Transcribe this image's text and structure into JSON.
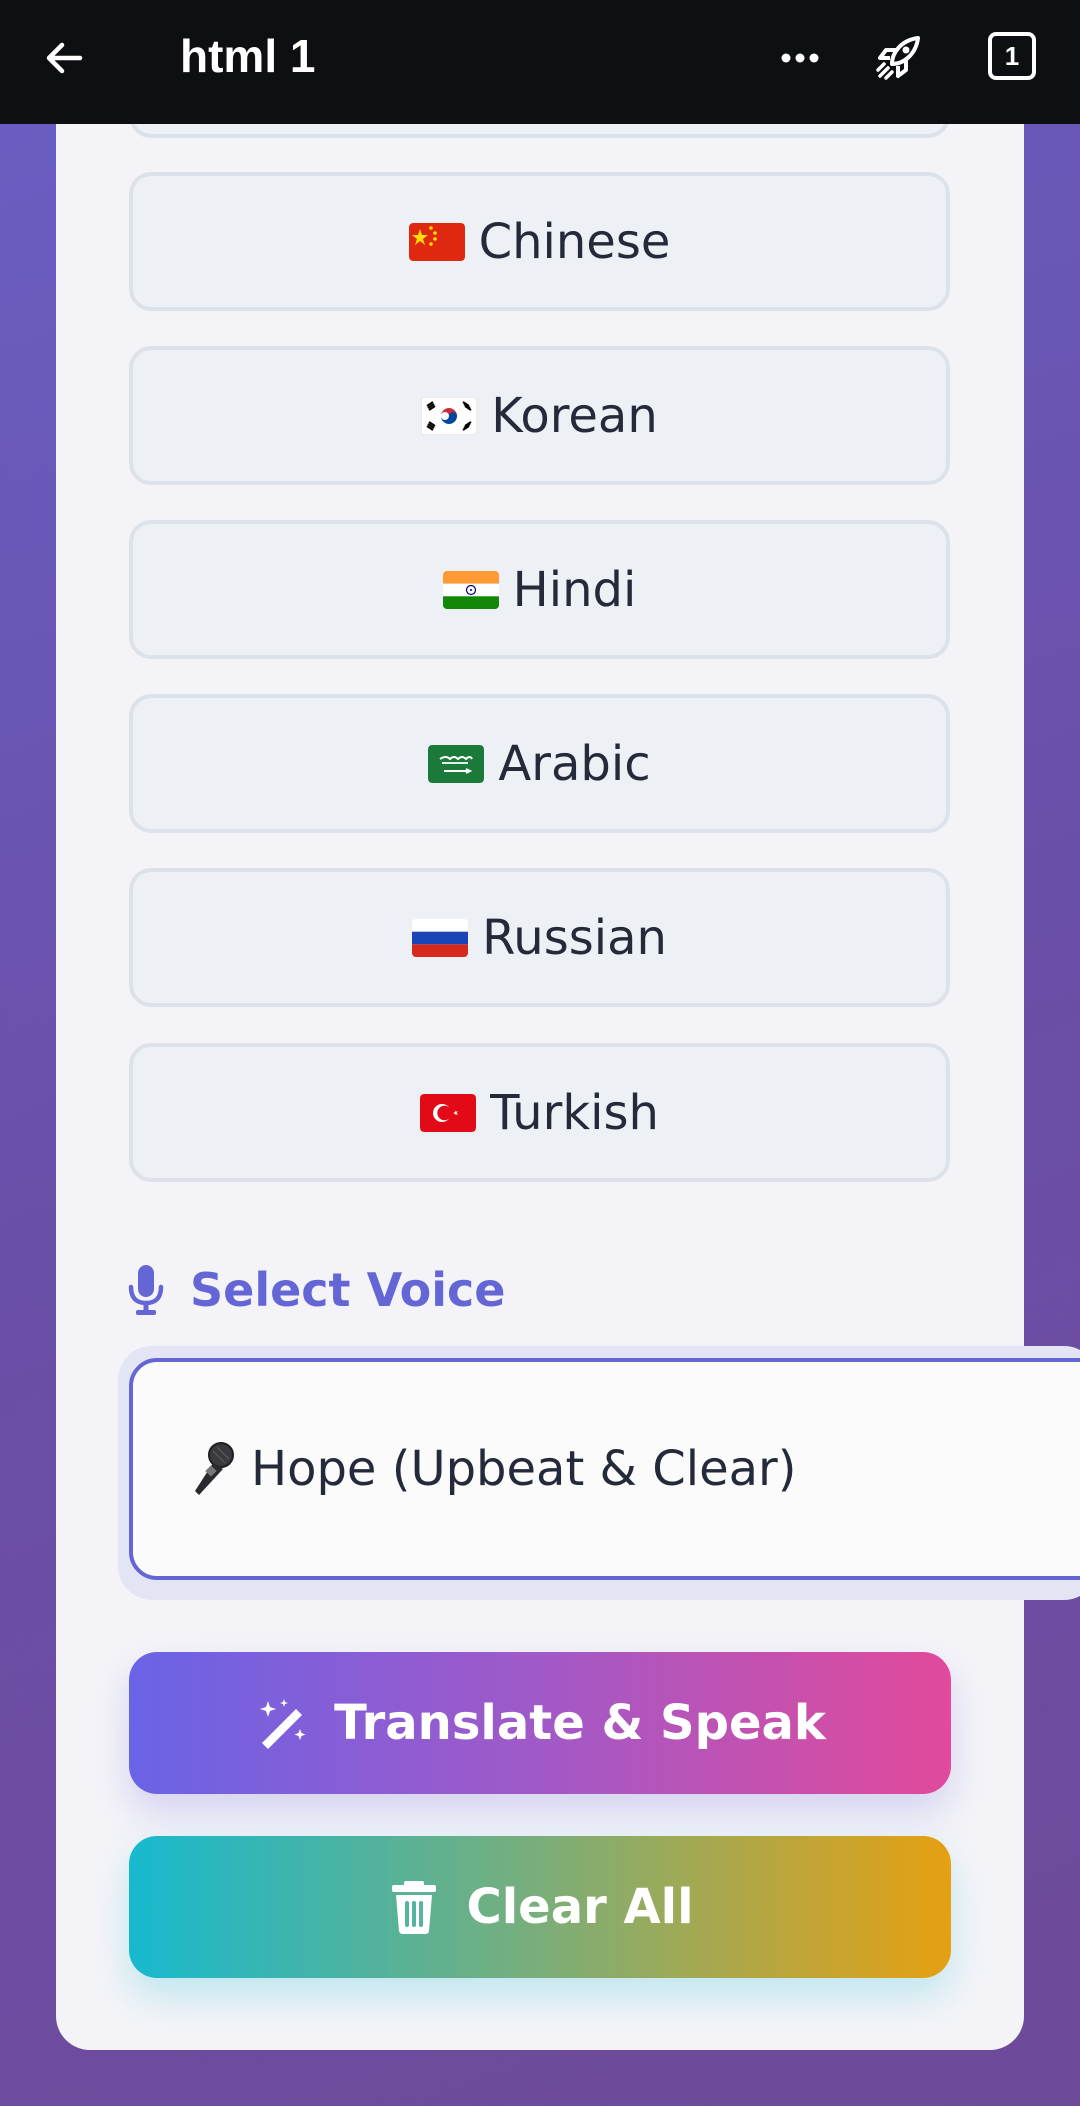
{
  "topbar": {
    "title": "html 1",
    "tab_count": "1",
    "icons": [
      "back-arrow-icon",
      "more-dots-icon",
      "rocket-icon",
      "tab-switcher-icon"
    ]
  },
  "languages": [
    {
      "flag": "cn-flag-icon",
      "label": "Chinese"
    },
    {
      "flag": "kr-flag-icon",
      "label": "Korean"
    },
    {
      "flag": "in-flag-icon",
      "label": "Hindi"
    },
    {
      "flag": "sa-flag-icon",
      "label": "Arabic"
    },
    {
      "flag": "ru-flag-icon",
      "label": "Russian"
    },
    {
      "flag": "tr-flag-icon",
      "label": "Turkish"
    }
  ],
  "voice": {
    "heading": "Select Voice",
    "selected": "Hope (Upbeat & Clear)"
  },
  "actions": {
    "translate_label": "Translate & Speak",
    "clear_label": "Clear All"
  },
  "colors": {
    "accent": "#6366d4",
    "translate_gradient": [
      "#6a63e6",
      "#e24a9b"
    ],
    "clear_gradient": [
      "#17b9cf",
      "#e6a012"
    ]
  }
}
